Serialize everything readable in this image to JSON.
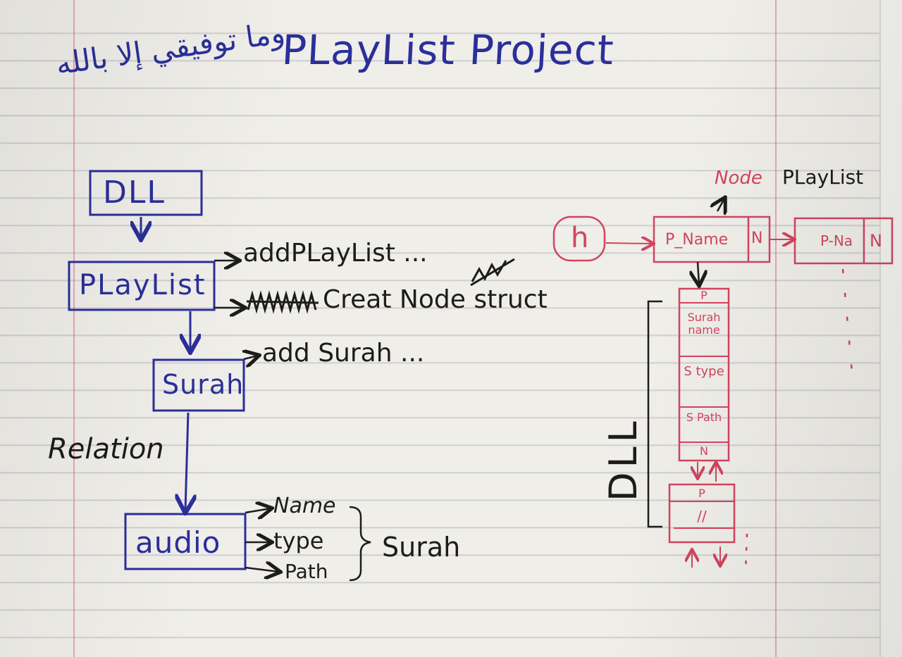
{
  "title": "PLayList Project",
  "arabic_heading": "وما توفيقي إلا بالله",
  "left_diagram": {
    "dll": "DLL",
    "playlist": "PLayList",
    "playlist_actions": [
      "addPLayList ...",
      "Creat Node struct"
    ],
    "surah": "Surah",
    "surah_actions": [
      "add Surah ..."
    ],
    "relation": "Relation",
    "audio": "audio",
    "audio_fields": [
      "Name",
      "type",
      "Path"
    ],
    "group_label": "Surah"
  },
  "right_diagram": {
    "node_caption_red": "Node",
    "node_caption_black": "PLayList",
    "head": "h",
    "node1_field": "P_Name",
    "node1_next": "N",
    "node2_field": "P-Na",
    "node2_next": "N",
    "surah_cells": [
      "P",
      "Surah name",
      "S type",
      "S Path",
      "N"
    ],
    "second_cells": [
      "P",
      "//"
    ],
    "dll_vertical": "DLL"
  },
  "colors": {
    "blue_ink": "#2a2f9a",
    "black_ink": "#1c1c1c",
    "red_ink": "#d2445e"
  }
}
